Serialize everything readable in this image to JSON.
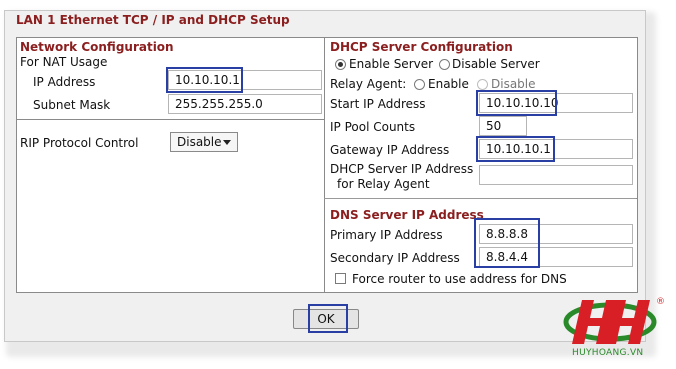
{
  "window": {
    "title": "LAN 1 Ethernet TCP / IP and DHCP Setup"
  },
  "network": {
    "section_title": "Network Configuration",
    "nat_label": "For NAT Usage",
    "ip_label": "IP Address",
    "ip_value": "10.10.10.1",
    "mask_label": "Subnet Mask",
    "mask_value": "255.255.255.0"
  },
  "rip": {
    "label": "RIP Protocol Control",
    "value": "Disable"
  },
  "dhcp": {
    "section_title": "DHCP Server Configuration",
    "enable_label": "Enable Server",
    "disable_label": "Disable Server",
    "relay_label": "Relay Agent:",
    "relay_enable": "Enable",
    "relay_disable": "Disable",
    "start_ip_label": "Start IP Address",
    "start_ip_value": "10.10.10.10",
    "pool_label": "IP Pool Counts",
    "pool_value": "50",
    "gateway_label": "Gateway IP Address",
    "gateway_value": "10.10.10.1",
    "relay_ip_label_1": "DHCP Server IP Address",
    "relay_ip_label_2": "for Relay Agent",
    "relay_ip_value": ""
  },
  "dns": {
    "section_title": "DNS Server IP Address",
    "primary_label": "Primary IP Address",
    "primary_value": "8.8.8.8",
    "secondary_label": "Secondary IP Address",
    "secondary_value": "8.8.4.4",
    "force_label": "Force router to use address for DNS"
  },
  "actions": {
    "ok": "OK"
  },
  "watermark": {
    "text": "HUYHOANG.VN",
    "reg": "®"
  },
  "colors": {
    "title": "#8b1e1e",
    "highlight": "#2a3fa3",
    "logo_red": "#d81f26",
    "logo_green": "#2a8a2a"
  }
}
